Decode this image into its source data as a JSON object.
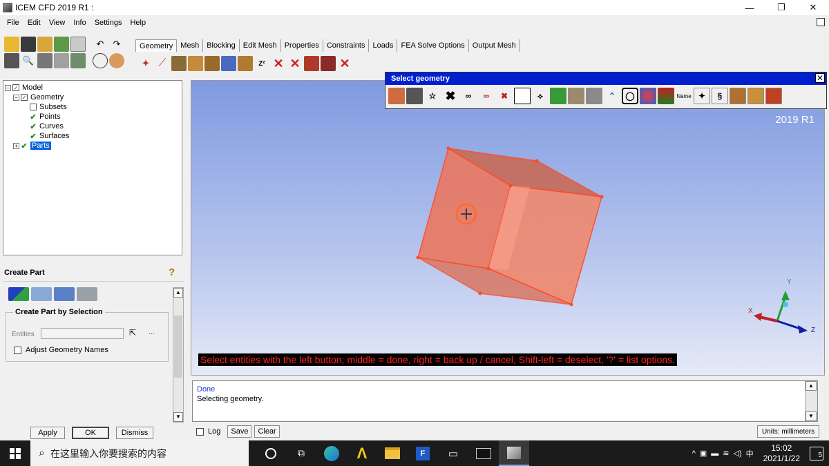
{
  "window": {
    "title": "ICEM CFD 2019 R1 :",
    "controls": [
      "—",
      "❐",
      "✕"
    ]
  },
  "menu": [
    "File",
    "Edit",
    "View",
    "Info",
    "Settings",
    "Help"
  ],
  "tabs": [
    "Geometry",
    "Mesh",
    "Blocking",
    "Edit Mesh",
    "Properties",
    "Constraints",
    "Loads",
    "FEA Solve Options",
    "Output Mesh"
  ],
  "active_tab": "Geometry",
  "tree": {
    "model": "Model",
    "geometry": "Geometry",
    "subsets": "Subsets",
    "points": "Points",
    "curves": "Curves",
    "surfaces": "Surfaces",
    "parts": "Parts"
  },
  "create_part": {
    "title": "Create Part",
    "help_icon": "?",
    "group_title": "Create Part by Selection",
    "entities_label": "Entities",
    "entities_value": "",
    "more": "...",
    "adjust_names": "Adjust Geometry Names",
    "apply": "Apply",
    "ok": "OK",
    "dismiss": "Dismiss"
  },
  "select_geometry": {
    "title": "Select geometry",
    "close": "✕",
    "name_icon_label": "Name"
  },
  "viewport": {
    "version": "2019 R1",
    "status_message": "Select entities with the left button; middle = done, right = back up / cancel, Shift-left = deselect, '?' = list options.",
    "axis_x": "X",
    "axis_y": "Y",
    "axis_z": "Z",
    "colors": {
      "cube_fill": "#f07d68",
      "cube_edge": "#ff4a26",
      "background_top": "#7f9ae0",
      "status_text": "#ff2020"
    }
  },
  "messages": {
    "line1": "Done",
    "line2": "Selecting geometry.",
    "log": "Log",
    "save": "Save",
    "clear": "Clear",
    "units": "Units: millimeters"
  },
  "taskbar": {
    "search_placeholder": "在这里输入你要搜索的内容",
    "ime": "中",
    "time": "15:02",
    "date": "2021/1/22",
    "notifications": "5"
  }
}
